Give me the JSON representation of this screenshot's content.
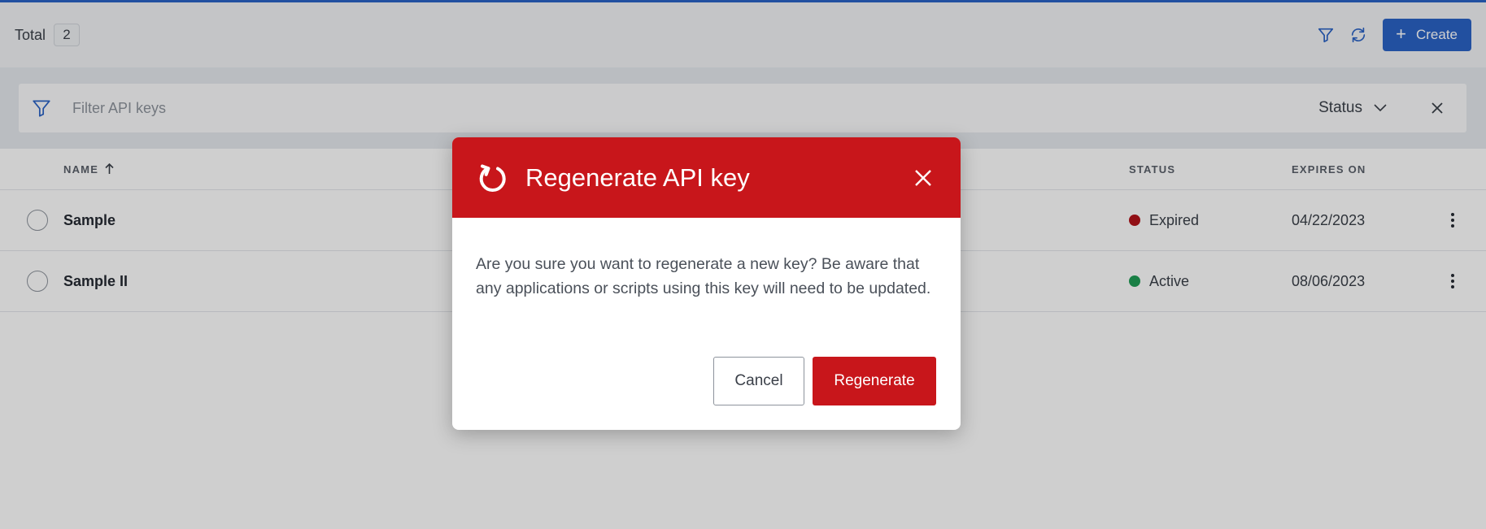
{
  "header": {
    "total_label": "Total",
    "total_count": "2",
    "create_label": "Create",
    "create_icon": "plus-icon",
    "filter_toggle_icon": "filter-icon",
    "refresh_icon": "refresh-icon"
  },
  "filter": {
    "placeholder": "Filter API keys",
    "value": "",
    "status_label": "Status",
    "clear_icon": "close-icon"
  },
  "table": {
    "columns": {
      "name": "NAME",
      "status": "STATUS",
      "expires": "EXPIRES ON"
    },
    "sort_indicator": "arrow-up-icon",
    "rows": [
      {
        "name": "Sample",
        "status": "Expired",
        "status_color": "#b3131a",
        "expires": "04/22/2023"
      },
      {
        "name": "Sample II",
        "status": "Active",
        "status_color": "#1f9d55",
        "expires": "08/06/2023"
      }
    ]
  },
  "modal": {
    "title": "Regenerate API key",
    "title_icon": "refresh-icon",
    "body": "Are you sure you want to regenerate a new key? Be aware that any applications or scripts using this key will need to be updated.",
    "cancel_label": "Cancel",
    "confirm_label": "Regenerate"
  },
  "colors": {
    "accent": "#2b63c5",
    "danger": "#c8161b"
  }
}
